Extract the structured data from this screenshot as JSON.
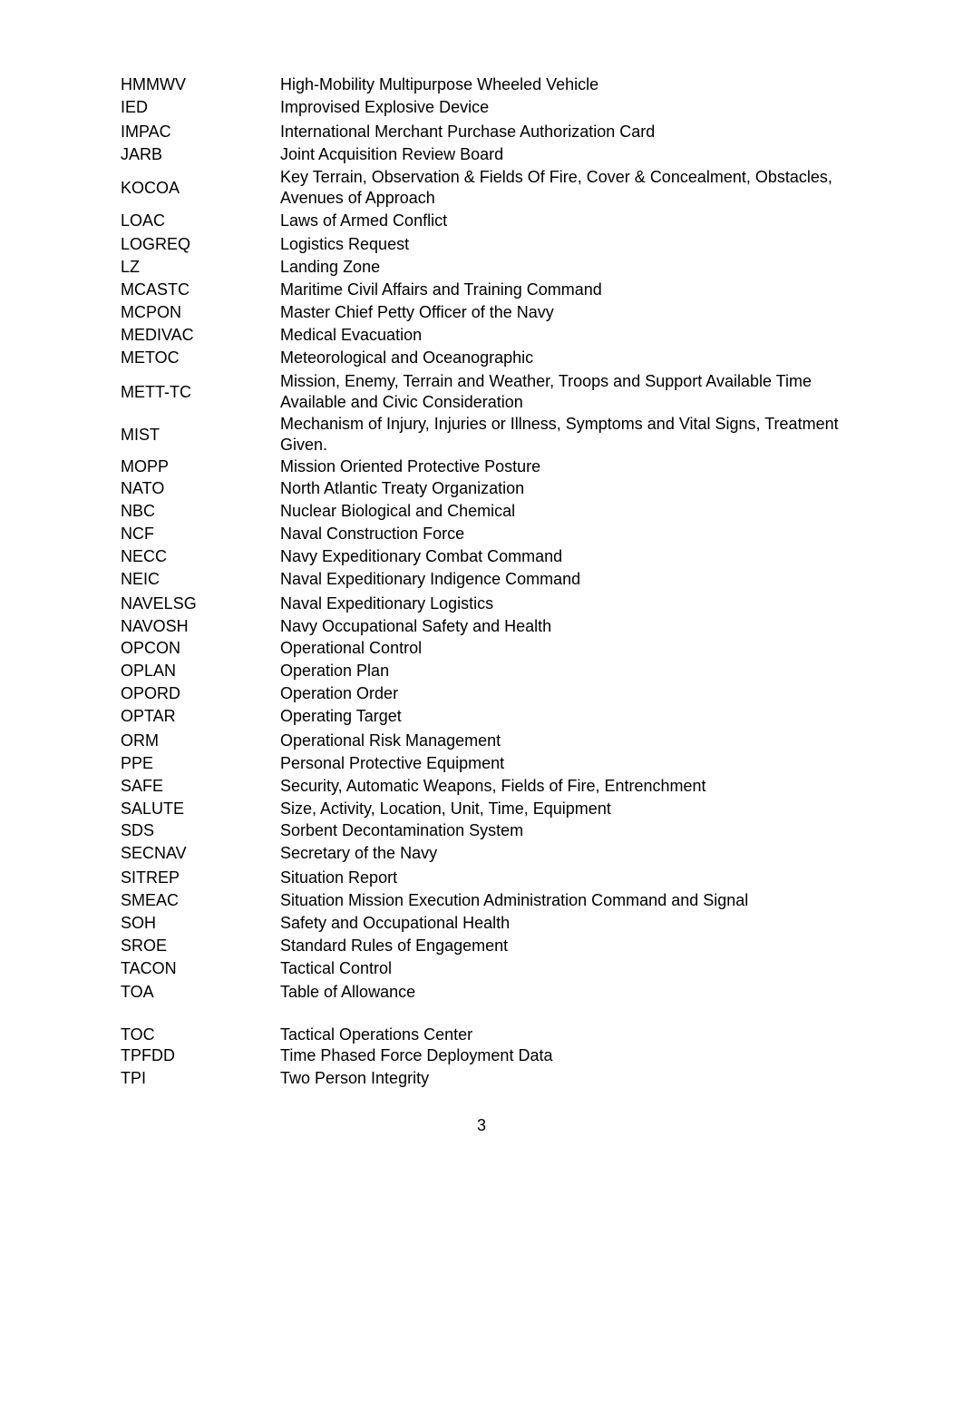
{
  "document": {
    "type": "acronym-list",
    "page_number": "3",
    "entries": [
      {
        "abbr": "HMMWV",
        "definition": "High-Mobility Multipurpose Wheeled Vehicle"
      },
      {
        "abbr": "IED",
        "definition": "Improvised Explosive Device"
      },
      {
        "abbr": "IMPAC",
        "definition": "International Merchant Purchase Authorization Card"
      },
      {
        "abbr": "JARB",
        "definition": "Joint Acquisition Review Board"
      },
      {
        "abbr": "KOCOA",
        "definition": "Key Terrain, Observation & Fields Of Fire, Cover & Concealment, Obstacles, Avenues of Approach"
      },
      {
        "abbr": "LOAC",
        "definition": "Laws of Armed Conflict"
      },
      {
        "abbr": "LOGREQ",
        "definition": "Logistics Request"
      },
      {
        "abbr": "LZ",
        "definition": "Landing Zone"
      },
      {
        "abbr": "MCASTC",
        "definition": "Maritime Civil Affairs and Training Command"
      },
      {
        "abbr": "MCPON",
        "definition": "Master Chief Petty Officer of the Navy"
      },
      {
        "abbr": "MEDIVAC",
        "definition": "Medical Evacuation"
      },
      {
        "abbr": "METOC",
        "definition": "Meteorological and Oceanographic"
      },
      {
        "abbr": "METT-TC",
        "definition": "Mission, Enemy, Terrain and Weather, Troops and Support Available Time Available and Civic Consideration"
      },
      {
        "abbr": "MIST",
        "definition": "Mechanism of Injury, Injuries or Illness, Symptoms and Vital Signs, Treatment Given."
      },
      {
        "abbr": "MOPP",
        "definition": "Mission Oriented Protective Posture"
      },
      {
        "abbr": "NATO",
        "definition": "North Atlantic Treaty Organization"
      },
      {
        "abbr": "NBC",
        "definition": "Nuclear Biological and Chemical"
      },
      {
        "abbr": "NCF",
        "definition": "Naval Construction Force"
      },
      {
        "abbr": "NECC",
        "definition": "Navy Expeditionary Combat Command"
      },
      {
        "abbr": "NEIC",
        "definition": "Naval Expeditionary Indigence Command"
      },
      {
        "abbr": "NAVELSG",
        "definition": "Naval Expeditionary Logistics"
      },
      {
        "abbr": "NAVOSH",
        "definition": "Navy Occupational Safety and Health"
      },
      {
        "abbr": "OPCON",
        "definition": "Operational Control"
      },
      {
        "abbr": "OPLAN",
        "definition": "Operation Plan"
      },
      {
        "abbr": "OPORD",
        "definition": "Operation Order"
      },
      {
        "abbr": "OPTAR",
        "definition": "Operating Target"
      },
      {
        "abbr": "ORM",
        "definition": "Operational Risk Management"
      },
      {
        "abbr": "PPE",
        "definition": "Personal Protective Equipment"
      },
      {
        "abbr": "SAFE",
        "definition": "Security, Automatic Weapons, Fields of Fire, Entrenchment"
      },
      {
        "abbr": "SALUTE",
        "definition": "Size, Activity, Location, Unit, Time, Equipment"
      },
      {
        "abbr": "SDS",
        "definition": "Sorbent Decontamination System"
      },
      {
        "abbr": "SECNAV",
        "definition": "Secretary of the Navy"
      },
      {
        "abbr": "SITREP",
        "definition": "Situation Report"
      },
      {
        "abbr": "SMEAC",
        "definition": "Situation Mission Execution Administration Command and Signal"
      },
      {
        "abbr": "SOH",
        "definition": "Safety and Occupational Health"
      },
      {
        "abbr": "SROE",
        "definition": "Standard Rules of Engagement"
      },
      {
        "abbr": "TACON",
        "definition": "Tactical Control"
      },
      {
        "abbr": "TOA",
        "definition": "Table of Allowance"
      },
      {
        "abbr": "TOC",
        "definition": "Tactical Operations Center"
      },
      {
        "abbr": "TPFDD",
        "definition": "Time Phased Force Deployment Data"
      },
      {
        "abbr": "TPI",
        "definition": "Two Person Integrity"
      }
    ]
  }
}
